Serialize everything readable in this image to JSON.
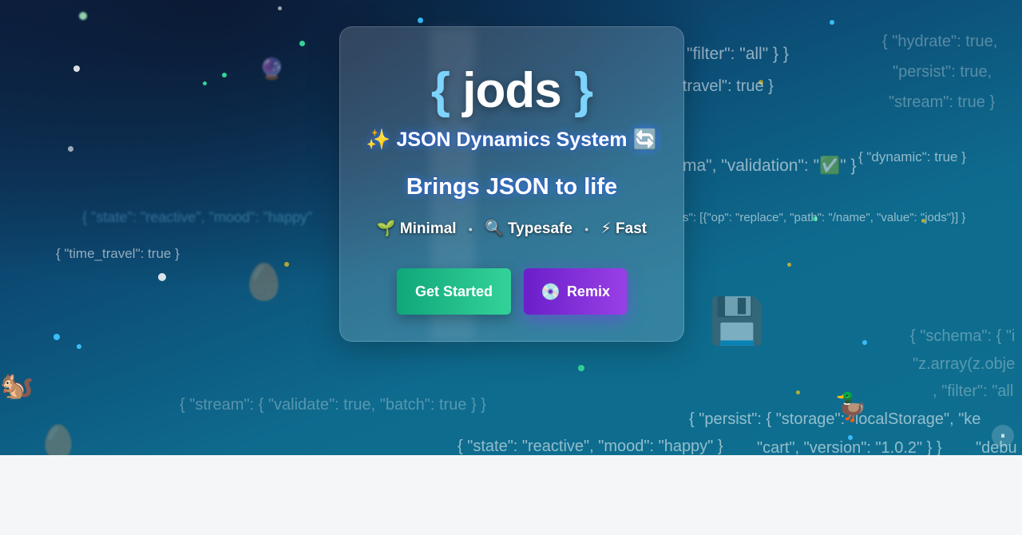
{
  "logo": {
    "brace_open": "{",
    "name": "jods",
    "brace_close": "}"
  },
  "subtitle": "✨ JSON Dynamics System 🔄",
  "tagline": "Brings JSON to life",
  "features": [
    {
      "icon": "🌱",
      "label": "Minimal"
    },
    {
      "icon": "🔍",
      "label": "Typesafe"
    },
    {
      "icon": "⚡",
      "label": "Fast"
    }
  ],
  "features_separator": "•",
  "buttons": {
    "get_started": "Get Started",
    "remix_icon": "💿",
    "remix": "Remix"
  },
  "pause_label": "⏸",
  "background": {
    "json_snippets": [
      "\"filter\": \"all\" } }",
      "travel\": true }",
      "{ \"hydrate\": true,",
      "\"persist\": true,",
      "\"stream\": true }",
      "ma\", \"validation\": \"✅\" }",
      "{ \"dynamic\": true }",
      "s\": [{\"op\": \"replace\", \"path\": \"/name\", \"value\": \"jods\"}] }",
      "{ \"state\": \"reactive\", \"mood\": \"happy\"",
      "{ \"time_travel\": true }",
      "{ \"schema\": { \"i",
      "\"z.array(z.obje",
      ", \"filter\": \"all",
      "{ \"stream\": { \"validate\": true, \"batch\": true } }",
      "{ \"persist\": { \"storage\": \"localStorage\", \"ke",
      "{ \"state\": \"reactive\", \"mood\": \"happy\" }",
      "\"cart\", \"version\": \"1.0.2\" } }",
      "\"debu"
    ],
    "emojis": [
      "🐿️",
      "🦆",
      "💾",
      "🔮",
      "🥚",
      "🥚"
    ]
  },
  "colors": {
    "brace": "#7dd3fc",
    "primary_button": "#10b981",
    "remix_button": "#7c3aed"
  }
}
